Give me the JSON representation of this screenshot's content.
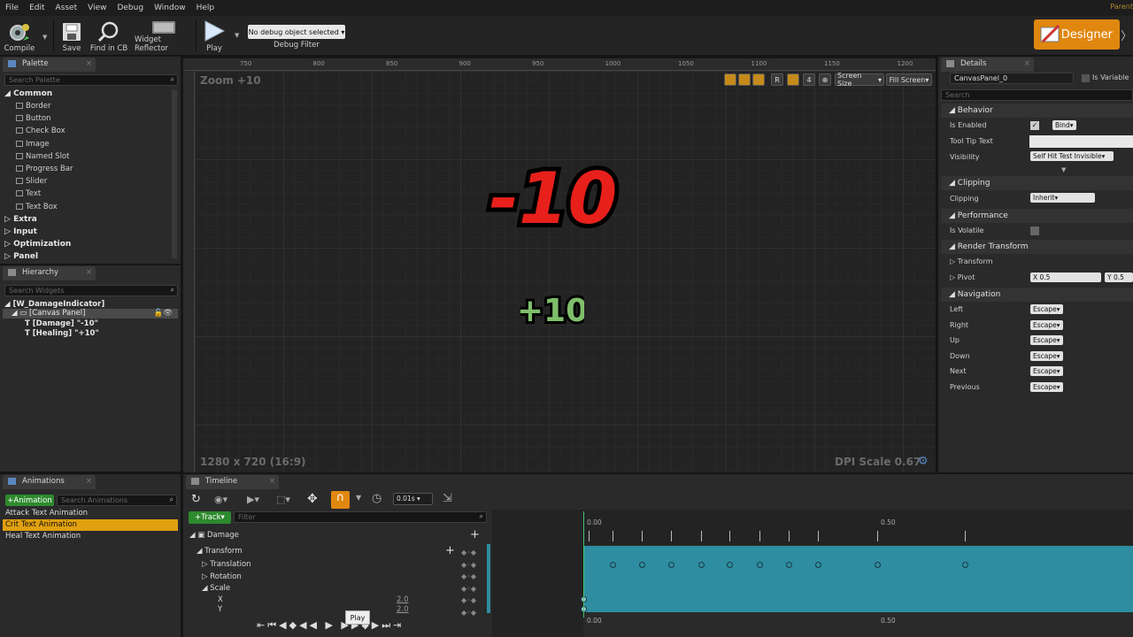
{
  "menu": [
    "File",
    "Edit",
    "Asset",
    "View",
    "Debug",
    "Window",
    "Help"
  ],
  "parent_tag": "Parent",
  "toolbar": {
    "compile": "Compile",
    "save": "Save",
    "find_in_cb": "Find in CB",
    "widget_reflector": "Widget Reflector",
    "play": "Play",
    "debug_object": "No debug object selected",
    "debug_filter": "Debug Filter",
    "designer": "Designer"
  },
  "palette": {
    "tab": "Palette",
    "search_placeholder": "Search Palette",
    "common": "Common",
    "items": [
      "Border",
      "Button",
      "Check Box",
      "Image",
      "Named Slot",
      "Progress Bar",
      "Slider",
      "Text",
      "Text Box"
    ],
    "categories": [
      "Extra",
      "Input",
      "Optimization",
      "Panel"
    ]
  },
  "hierarchy": {
    "tab": "Hierarchy",
    "search_placeholder": "Search Widgets",
    "root": "[W_DamageIndicator]",
    "canvas": "[Canvas Panel]",
    "children": [
      "[Damage] \"-10\"",
      "[Healing] \"+10\""
    ]
  },
  "designer": {
    "zoom": "Zoom +10",
    "resolution": "1280 x 720 (16:9)",
    "dpi": "DPI Scale 0.67",
    "screen_size": "Screen Size",
    "fill_screen": "Fill Screen",
    "r_btn": "R",
    "num_btn": "4",
    "ruler_ticks": [
      "750",
      "800",
      "850",
      "900",
      "950",
      "1000",
      "1050",
      "1100",
      "1150",
      "1200"
    ],
    "damage_text": "-10",
    "healing_text": "+10"
  },
  "details": {
    "tab": "Details",
    "name": "CanvasPanel_0",
    "is_variable": "Is Variable",
    "search_placeholder": "Search",
    "behavior": "Behavior",
    "is_enabled": "Is Enabled",
    "bind": "Bind",
    "tooltip": "Tool Tip Text",
    "visibility": "Visibility",
    "visibility_value": "Self Hit Test Invisible",
    "clipping_section": "Clipping",
    "clipping": "Clipping",
    "clipping_value": "Inherit",
    "performance": "Performance",
    "is_volatile": "Is Volatile",
    "render_transform": "Render Transform",
    "transform": "Transform",
    "pivot": "Pivot",
    "pivot_x": "X  0.5",
    "pivot_y": "Y  0.5",
    "navigation": "Navigation",
    "nav_rows": [
      "Left",
      "Right",
      "Up",
      "Down",
      "Next",
      "Previous"
    ],
    "escape": "Escape"
  },
  "animations": {
    "tab": "Animations",
    "add_btn": "+Animation",
    "search_placeholder": "Search Animations",
    "items": [
      "Attack Text Animation",
      "Crit Text Animation",
      "Heal Text Animation"
    ],
    "selected_index": 1
  },
  "timeline": {
    "tab": "Timeline",
    "snap_value": "0.01s",
    "track_btn": "+Track",
    "filter_placeholder": "Filter",
    "damage": "Damage",
    "transform": "Transform",
    "translation": "Translation",
    "rotation": "Rotation",
    "scale": "Scale",
    "x": "X",
    "y": "Y",
    "x_value": "2.0",
    "y_value": "2.0",
    "time_start": "0.00",
    "time_mid": "0.50",
    "tooltip": "Play"
  },
  "colors": {
    "accent": "#e0870f",
    "track": "#2e8da1",
    "damage": "#e8201c",
    "healing": "#7fbf6a"
  }
}
